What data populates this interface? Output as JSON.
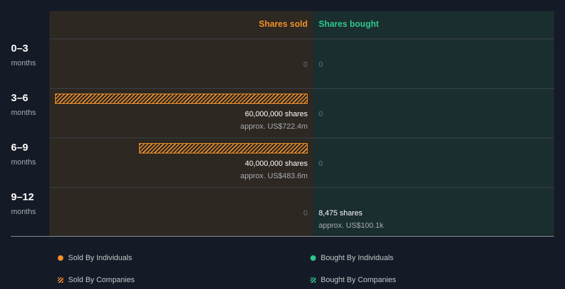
{
  "header": {
    "sold_label": "Shares sold",
    "bought_label": "Shares bought"
  },
  "rows": [
    {
      "range": "0–3",
      "unit": "months",
      "sold_shares_text": "0",
      "sold_value_text": "",
      "bought_shares_text": "0",
      "bought_value_text": ""
    },
    {
      "range": "3–6",
      "unit": "months",
      "sold_shares_text": "60,000,000 shares",
      "sold_value_text": "approx. US$722.4m",
      "bought_shares_text": "0",
      "bought_value_text": ""
    },
    {
      "range": "6–9",
      "unit": "months",
      "sold_shares_text": "40,000,000 shares",
      "sold_value_text": "approx. US$483.6m",
      "bought_shares_text": "0",
      "bought_value_text": ""
    },
    {
      "range": "9–12",
      "unit": "months",
      "sold_shares_text": "0",
      "sold_value_text": "",
      "bought_shares_text": "8,475 shares",
      "bought_value_text": "approx. US$100.1k"
    }
  ],
  "legend": {
    "sold_individuals": "Sold By Individuals",
    "bought_individuals": "Bought By Individuals",
    "sold_companies": "Sold By Companies",
    "bought_companies": "Bought By Companies"
  },
  "colors": {
    "sold": "#f0902a",
    "bought": "#2fc58c",
    "sold_bg": "#2d2822",
    "bought_bg": "#1a2e30"
  },
  "chart_data": {
    "type": "bar",
    "categories": [
      "0–3",
      "3–6",
      "6–9",
      "9–12"
    ],
    "series": [
      {
        "name": "Sold By Companies",
        "values": [
          0,
          60000000,
          40000000,
          0
        ],
        "value_usd": [
          0,
          722400000,
          483600000,
          0
        ]
      },
      {
        "name": "Bought By Individuals",
        "values": [
          0,
          0,
          0,
          8475
        ],
        "value_usd": [
          0,
          0,
          0,
          100100
        ]
      }
    ],
    "orientation": "horizontal-diverging",
    "legend_position": "bottom"
  }
}
